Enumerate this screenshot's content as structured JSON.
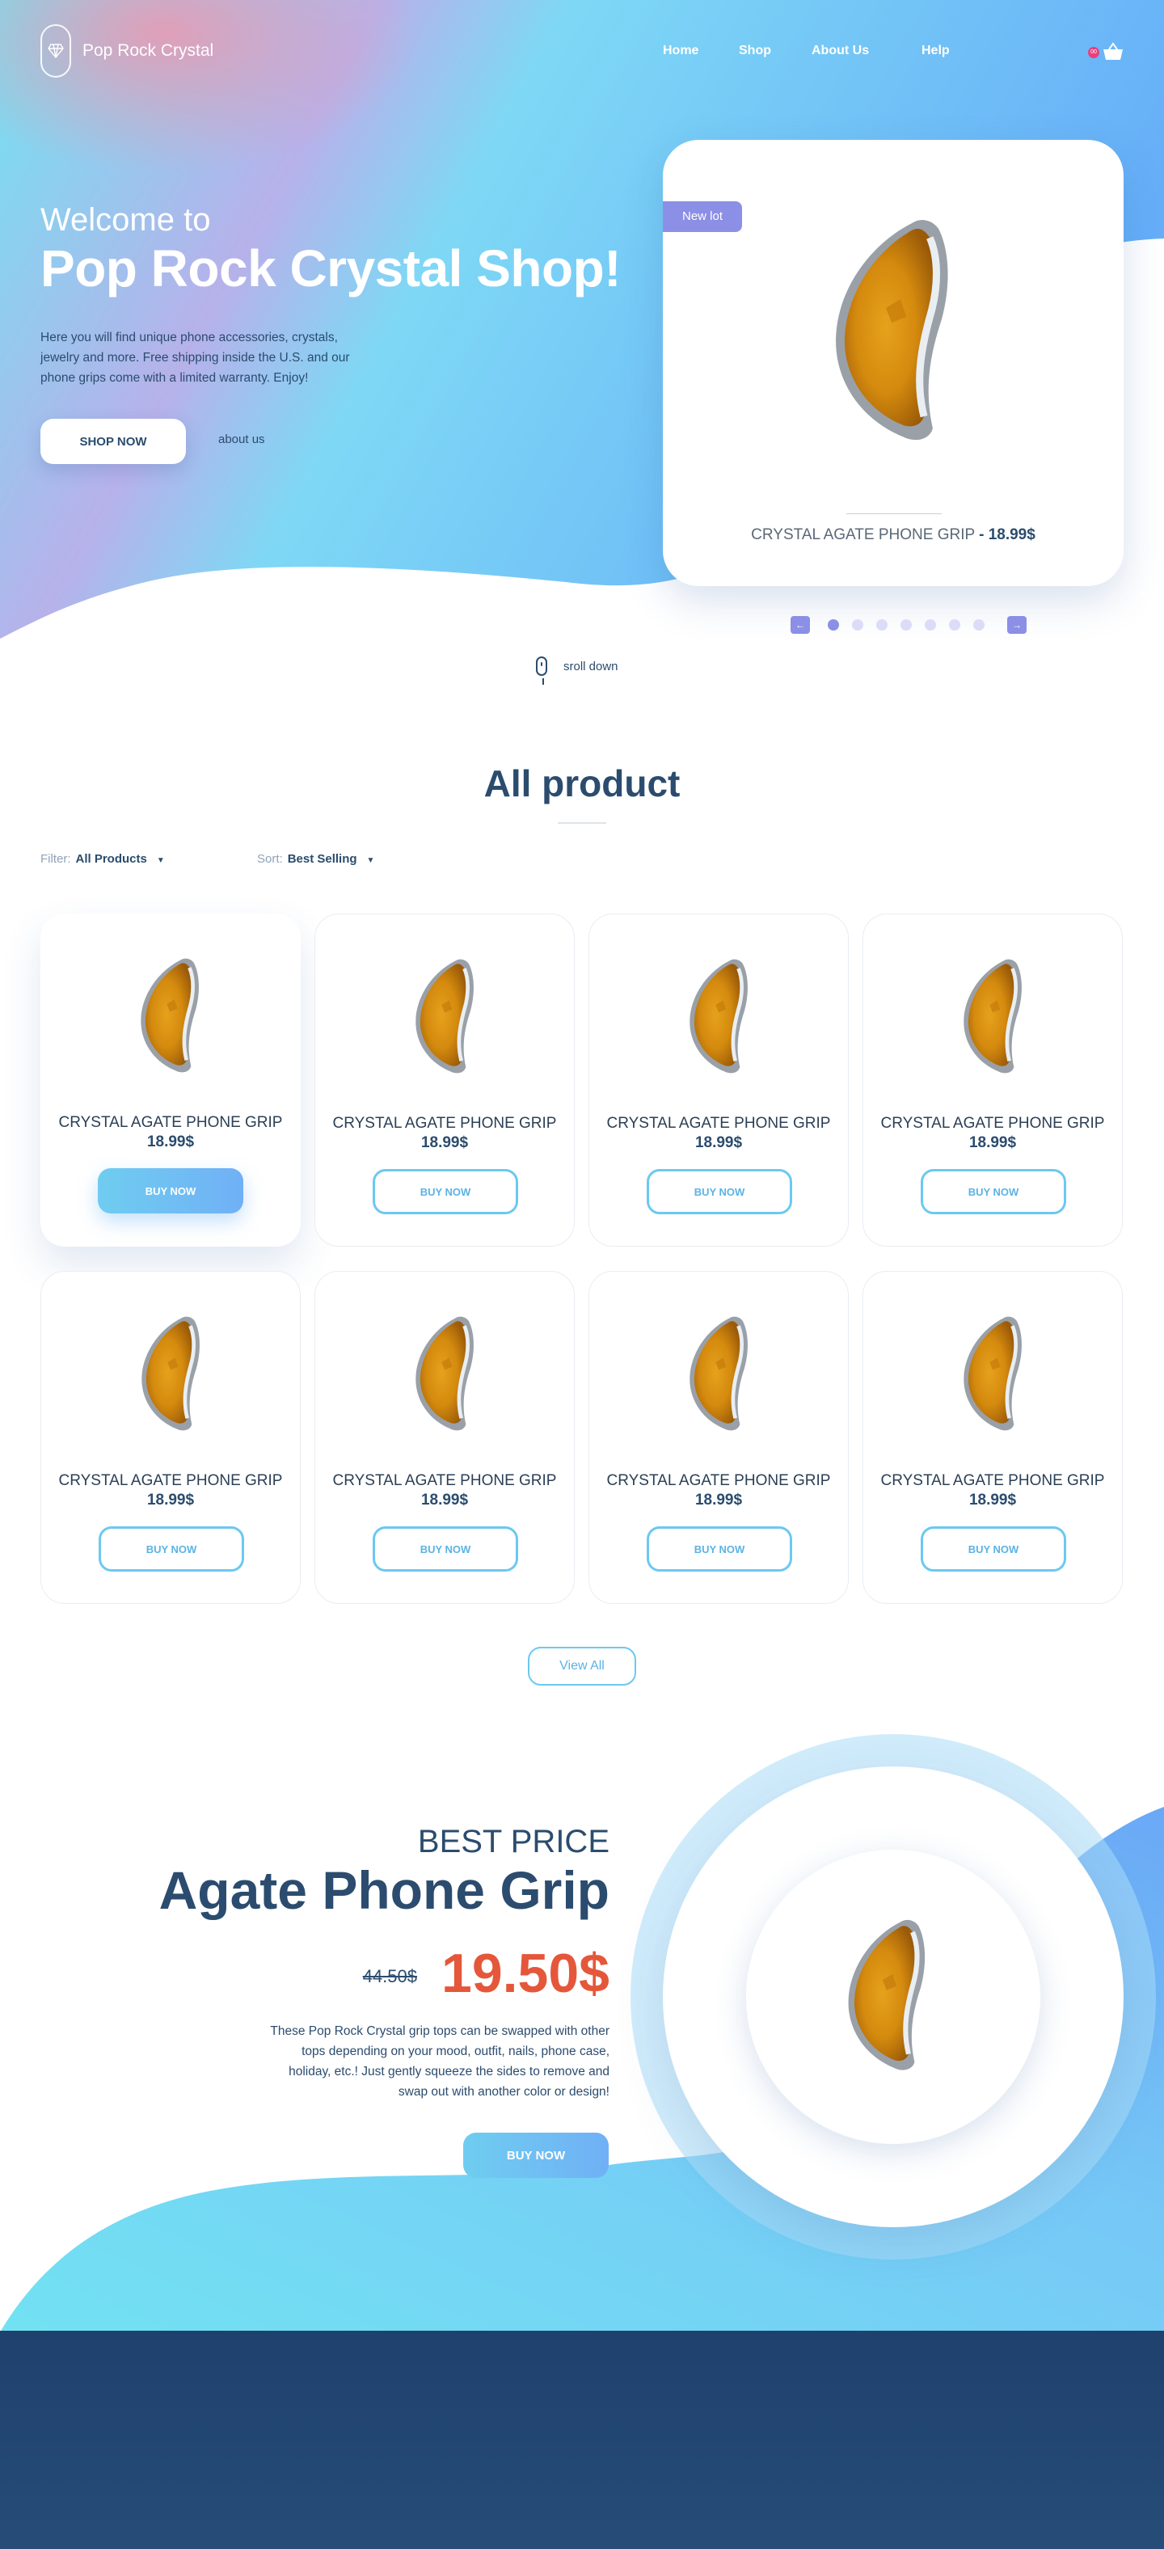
{
  "brand": {
    "name": "Pop Rock Crystal"
  },
  "nav": {
    "home": "Home",
    "shop": "Shop",
    "about": "About Us",
    "help": "Help",
    "cart_count": "00"
  },
  "hero": {
    "welcome": "Welcome to",
    "title": "Pop Rock Crystal Shop!",
    "intro": "Here you will find unique phone accessories, crystals, jewelry and more. Free shipping inside the U.S. and our phone grips come with a limited warranty. Enjoy!",
    "shop_now": "SHOP NOW",
    "about_link": "about us",
    "scroll": "sroll down"
  },
  "featured": {
    "badge": "New lot",
    "name": "CRYSTAL AGATE PHONE GRIP",
    "price": "- 18.99$",
    "slide_count": 7,
    "active_slide": 1
  },
  "products": {
    "title": "All product",
    "filter_label": "Filter:",
    "filter_value": "All Products",
    "sort_label": "Sort:",
    "sort_value": "Best Selling",
    "items": [
      {
        "name": "CRYSTAL AGATE PHONE GRIP",
        "price": "18.99$",
        "button": "BUY NOW"
      },
      {
        "name": "CRYSTAL AGATE PHONE GRIP",
        "price": "18.99$",
        "button": "BUY NOW"
      },
      {
        "name": "CRYSTAL AGATE PHONE GRIP",
        "price": "18.99$",
        "button": "BUY NOW"
      },
      {
        "name": "CRYSTAL AGATE PHONE GRIP",
        "price": "18.99$",
        "button": "BUY NOW"
      },
      {
        "name": "CRYSTAL AGATE PHONE GRIP",
        "price": "18.99$",
        "button": "BUY NOW"
      },
      {
        "name": "CRYSTAL AGATE PHONE GRIP",
        "price": "18.99$",
        "button": "BUY NOW"
      },
      {
        "name": "CRYSTAL AGATE PHONE GRIP",
        "price": "18.99$",
        "button": "BUY NOW"
      },
      {
        "name": "CRYSTAL AGATE PHONE GRIP",
        "price": "18.99$",
        "button": "BUY NOW"
      }
    ],
    "view_all": "View All"
  },
  "promo": {
    "eyebrow": "BEST PRICE",
    "title": "Agate Phone Grip",
    "old_price": "44.50$",
    "new_price": "19.50$",
    "description": "These Pop Rock Crystal grip tops can be swapped with other tops depending on your mood, outfit, nails, phone case, holiday, etc.! Just gently squeeze the sides to remove and swap out with another color or design!",
    "button": "BUY NOW"
  },
  "colors": {
    "accent_blue": "#6cc8f2",
    "purple": "#8c8fe6",
    "navy": "#2b4c6e",
    "sale_red": "#e5573a",
    "footer": "#234770"
  }
}
